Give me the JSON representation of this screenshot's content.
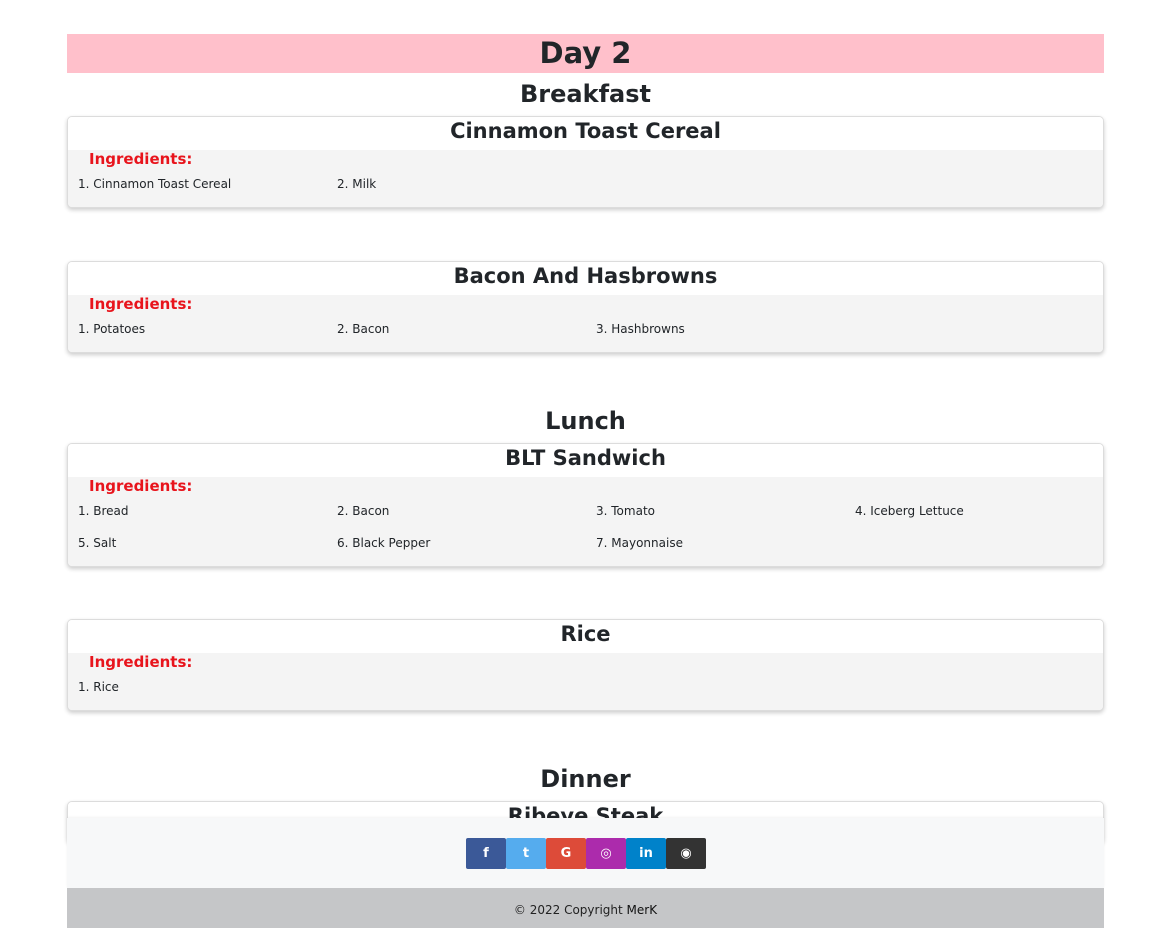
{
  "day_title": "Day 2",
  "sections": {
    "breakfast": "Breakfast",
    "lunch": "Lunch",
    "dinner": "Dinner"
  },
  "ingredients_label": "Ingredients:",
  "recipes": [
    {
      "title": "Cinnamon Toast Cereal",
      "ingredients": [
        "1. Cinnamon Toast Cereal",
        "2. Milk"
      ]
    },
    {
      "title": "Bacon And Hasbrowns",
      "ingredients": [
        "1. Potatoes",
        "2. Bacon",
        "3. Hashbrowns"
      ]
    },
    {
      "title": "BLT Sandwich",
      "ingredients": [
        "1. Bread",
        "2. Bacon",
        "3. Tomato",
        "4. Iceberg Lettuce",
        "5. Salt",
        "6. Black Pepper",
        "7. Mayonnaise"
      ]
    },
    {
      "title": "Rice",
      "ingredients": [
        "1. Rice"
      ]
    },
    {
      "title": "Ribeye Steak",
      "ingredients": []
    }
  ],
  "social": [
    {
      "name": "facebook-icon",
      "glyph": "f",
      "color": "#3b5998"
    },
    {
      "name": "twitter-icon",
      "glyph": "t",
      "color": "#55acee"
    },
    {
      "name": "google-icon",
      "glyph": "G",
      "color": "#dd4b39"
    },
    {
      "name": "instagram-icon",
      "glyph": "◎",
      "color": "#ac2bac"
    },
    {
      "name": "linkedin-icon",
      "glyph": "in",
      "color": "#0082ca"
    },
    {
      "name": "github-icon",
      "glyph": "◉",
      "color": "#333333"
    }
  ],
  "footer": {
    "copyright": "© 2022 Copyright ",
    "owner": "MerK"
  }
}
